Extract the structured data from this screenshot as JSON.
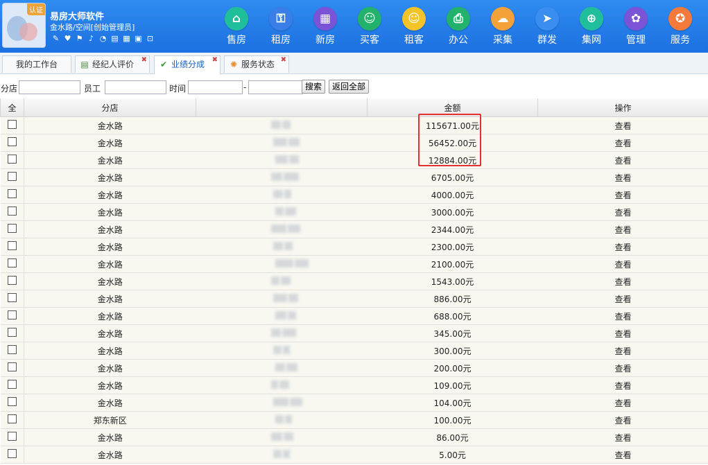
{
  "app": {
    "title": "易房大师软件",
    "subtitle": "金水路/空间[创始管理员]",
    "logo_badge": "认证"
  },
  "toolbar_icons": [
    "pencil-icon",
    "shirt-icon",
    "flag-icon",
    "bell-icon",
    "pie-icon",
    "document-icon",
    "calculator-icon",
    "id-card-icon",
    "lock-icon"
  ],
  "nav": [
    {
      "label": "售房",
      "icon": "home-icon",
      "color": "#1fbf9b",
      "glyph": "⌂"
    },
    {
      "label": "租房",
      "icon": "house-key-icon",
      "color": "#3a7fe8",
      "glyph": "⚿"
    },
    {
      "label": "新房",
      "icon": "building-icon",
      "color": "#7a53d6",
      "glyph": "▦"
    },
    {
      "label": "买客",
      "icon": "user-icon",
      "color": "#23b26b",
      "glyph": "☺"
    },
    {
      "label": "租客",
      "icon": "user-plus-icon",
      "color": "#f3c42a",
      "glyph": "☺"
    },
    {
      "label": "办公",
      "icon": "printer-icon",
      "color": "#23b26b",
      "glyph": "⎙"
    },
    {
      "label": "采集",
      "icon": "cloud-download-icon",
      "color": "#f3a23a",
      "glyph": "☁"
    },
    {
      "label": "群发",
      "icon": "send-icon",
      "color": "#3a8ef0",
      "glyph": "➤"
    },
    {
      "label": "集网",
      "icon": "network-icon",
      "color": "#1fbf9b",
      "glyph": "⊕"
    },
    {
      "label": "管理",
      "icon": "gear-icon",
      "color": "#7a53d6",
      "glyph": "✿"
    },
    {
      "label": "服务",
      "icon": "star-badge-icon",
      "color": "#f37a3a",
      "glyph": "✪"
    }
  ],
  "tabs": [
    {
      "label": "我的工作台",
      "icon": "",
      "closable": false
    },
    {
      "label": "经纪人评价",
      "icon": "table-icon",
      "closable": true
    },
    {
      "label": "业绩分成",
      "icon": "check-icon",
      "closable": true,
      "active": true
    },
    {
      "label": "服务状态",
      "icon": "flower-icon",
      "closable": true
    }
  ],
  "search": {
    "branch_label": "分店",
    "staff_label": "员工",
    "time_label": "时间",
    "range_sep": "-",
    "search_button": "搜索",
    "reset_button": "返回全部"
  },
  "table": {
    "headers": [
      "全",
      "分店",
      "",
      "金额",
      "操作"
    ],
    "rows": [
      {
        "branch": "金水路",
        "amount": "115671.00元",
        "action": "查看"
      },
      {
        "branch": "金水路",
        "amount": "56452.00元",
        "action": "查看"
      },
      {
        "branch": "金水路",
        "amount": "12884.00元",
        "action": "查看"
      },
      {
        "branch": "金水路",
        "amount": "6705.00元",
        "action": "查看"
      },
      {
        "branch": "金水路",
        "amount": "4000.00元",
        "action": "查看"
      },
      {
        "branch": "金水路",
        "amount": "3000.00元",
        "action": "查看"
      },
      {
        "branch": "金水路",
        "amount": "2344.00元",
        "action": "查看"
      },
      {
        "branch": "金水路",
        "amount": "2300.00元",
        "action": "查看"
      },
      {
        "branch": "金水路",
        "amount": "2100.00元",
        "action": "查看"
      },
      {
        "branch": "金水路",
        "amount": "1543.00元",
        "action": "查看"
      },
      {
        "branch": "金水路",
        "amount": "886.00元",
        "action": "查看"
      },
      {
        "branch": "金水路",
        "amount": "688.00元",
        "action": "查看"
      },
      {
        "branch": "金水路",
        "amount": "345.00元",
        "action": "查看"
      },
      {
        "branch": "金水路",
        "amount": "300.00元",
        "action": "查看"
      },
      {
        "branch": "金水路",
        "amount": "200.00元",
        "action": "查看"
      },
      {
        "branch": "金水路",
        "amount": "109.00元",
        "action": "查看"
      },
      {
        "branch": "金水路",
        "amount": "104.00元",
        "action": "查看"
      },
      {
        "branch": "郑东新区",
        "amount": "100.00元",
        "action": "查看"
      },
      {
        "branch": "金水路",
        "amount": "86.00元",
        "action": "查看"
      },
      {
        "branch": "金水路",
        "amount": "5.00元",
        "action": "查看"
      }
    ]
  },
  "colors": {
    "header_blue": "#1c70e0",
    "highlight": "#e53030",
    "row_bg": "#f8f8f1"
  }
}
